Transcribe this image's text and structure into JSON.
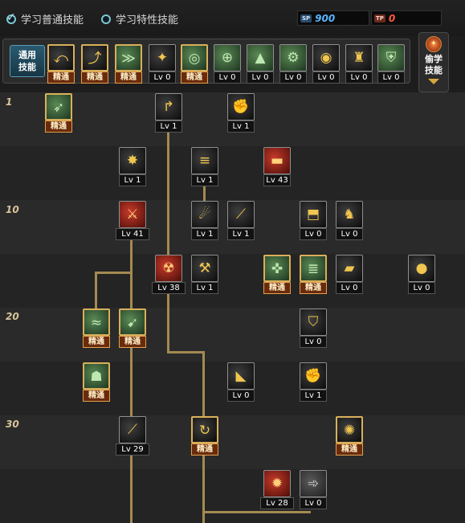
{
  "top": {
    "opt_normal": "学习普通技能",
    "opt_special": "学习特性技能",
    "sp_icon": "SP",
    "sp_value": "900",
    "tp_icon": "TP",
    "tp_value": "0",
    "colors": {
      "sp": "#5ab4ff",
      "tp": "#ff5a3a",
      "accent": "#d8b05a"
    }
  },
  "quickbar": {
    "general_label_1": "通用",
    "general_label_2": "技能",
    "items": [
      {
        "icon": "backstep-icon",
        "cap": "精通"
      },
      {
        "icon": "leap-icon",
        "cap": "精通"
      },
      {
        "icon": "quick-rebound-icon",
        "cap": "精通"
      },
      {
        "icon": "eagle-icon",
        "cap": "Lv 0"
      },
      {
        "icon": "target-icon",
        "cap": "精通"
      },
      {
        "icon": "crosshair-icon",
        "cap": "Lv 0"
      },
      {
        "icon": "cannon-icon",
        "cap": "Lv 0"
      },
      {
        "icon": "gear-cannon-icon",
        "cap": "Lv 0"
      },
      {
        "icon": "eye-icon",
        "cap": "Lv 0"
      },
      {
        "icon": "soldier-icon",
        "cap": "Lv 0"
      },
      {
        "icon": "armor-icon",
        "cap": "Lv 0"
      }
    ]
  },
  "steal": {
    "label_1": "偷学",
    "label_2": "技能"
  },
  "level_marks": [
    "1",
    "10",
    "20",
    "30"
  ],
  "tree": [
    {
      "icon": "kick-icon",
      "cap": "精通"
    },
    {
      "icon": "arrow-curve-icon",
      "cap": "Lv 1"
    },
    {
      "icon": "uppercut-icon",
      "cap": "Lv 1"
    },
    {
      "icon": "burst-icon",
      "cap": "Lv 1"
    },
    {
      "icon": "rapid-fire-icon",
      "cap": "Lv 1"
    },
    {
      "icon": "bazooka-icon",
      "cap": "Lv 43"
    },
    {
      "icon": "claw-icon",
      "cap": "Lv 41"
    },
    {
      "icon": "dragon-icon",
      "cap": "Lv 1"
    },
    {
      "icon": "spear-icon",
      "cap": "Lv 1"
    },
    {
      "icon": "deploy-icon",
      "cap": "Lv 0"
    },
    {
      "icon": "beast-icon",
      "cap": "Lv 0"
    },
    {
      "icon": "mech-icon",
      "cap": "Lv 38"
    },
    {
      "icon": "hammer-icon",
      "cap": "Lv 1"
    },
    {
      "icon": "gunner-icon",
      "cap": "精通"
    },
    {
      "icon": "machine-gun-icon",
      "cap": "精通"
    },
    {
      "icon": "tank-icon",
      "cap": "Lv 0"
    },
    {
      "icon": "grenade-icon",
      "cap": "Lv 0"
    },
    {
      "icon": "wind-icon",
      "cap": "精通"
    },
    {
      "icon": "dash-icon",
      "cap": "精通"
    },
    {
      "icon": "shield-icon",
      "cap": "Lv 0"
    },
    {
      "icon": "helmet-icon",
      "cap": "精通"
    },
    {
      "icon": "boot-icon",
      "cap": "Lv 0"
    },
    {
      "icon": "fist-icon",
      "cap": "Lv 1"
    },
    {
      "icon": "blade-icon",
      "cap": "Lv 29"
    },
    {
      "icon": "flip-icon",
      "cap": "精通"
    },
    {
      "icon": "swirl-icon",
      "cap": "精通"
    },
    {
      "icon": "explosion-icon",
      "cap": "Lv 28"
    },
    {
      "icon": "runner-icon",
      "cap": "Lv 0"
    }
  ]
}
